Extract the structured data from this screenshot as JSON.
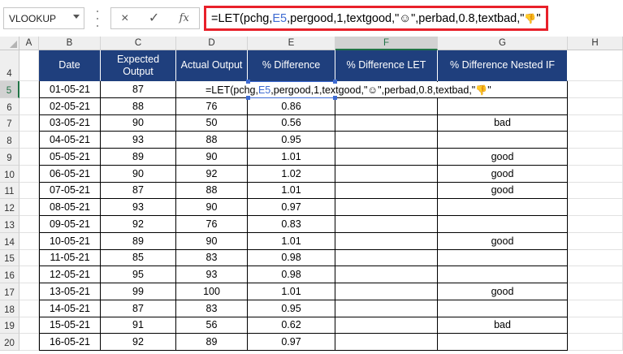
{
  "formula_bar": {
    "name_box": "VLOOKUP",
    "cancel_icon": "×",
    "enter_icon": "✓",
    "fx_label": "fx",
    "formula_prefix": "=LET(pchg,",
    "formula_ref": "E5",
    "formula_mid": ",pergood,1,textgood,\"",
    "smiley": "☺",
    "formula_mid2": "\",perbad,0.8,textbad,\"",
    "thumbs_down": "👎",
    "formula_suffix": "\""
  },
  "columns": [
    "A",
    "B",
    "C",
    "D",
    "E",
    "F",
    "G",
    "H"
  ],
  "selected_column": "F",
  "selected_row": "5",
  "headers": {
    "date": "Date",
    "expected_line1": "Expected",
    "expected_line2": "Output",
    "actual": "Actual Output",
    "pct_diff": "% Difference",
    "pct_let": "% Difference LET",
    "pct_nested": "% Difference Nested IF"
  },
  "row_numbers": [
    "4",
    "5",
    "6",
    "7",
    "8",
    "9",
    "10",
    "11",
    "12",
    "13",
    "14",
    "15",
    "16",
    "17",
    "18",
    "19",
    "20"
  ],
  "rows": [
    {
      "row": "5",
      "date": "01-05-21",
      "expected": "87",
      "actual": "",
      "pct": "",
      "let": "",
      "nested": ""
    },
    {
      "row": "6",
      "date": "02-05-21",
      "expected": "88",
      "actual": "76",
      "pct": "0.86",
      "let": "",
      "nested": ""
    },
    {
      "row": "7",
      "date": "03-05-21",
      "expected": "90",
      "actual": "50",
      "pct": "0.56",
      "let": "",
      "nested": "bad"
    },
    {
      "row": "8",
      "date": "04-05-21",
      "expected": "93",
      "actual": "88",
      "pct": "0.95",
      "let": "",
      "nested": ""
    },
    {
      "row": "9",
      "date": "05-05-21",
      "expected": "89",
      "actual": "90",
      "pct": "1.01",
      "let": "",
      "nested": "good"
    },
    {
      "row": "10",
      "date": "06-05-21",
      "expected": "90",
      "actual": "92",
      "pct": "1.02",
      "let": "",
      "nested": "good"
    },
    {
      "row": "11",
      "date": "07-05-21",
      "expected": "87",
      "actual": "88",
      "pct": "1.01",
      "let": "",
      "nested": "good"
    },
    {
      "row": "12",
      "date": "08-05-21",
      "expected": "93",
      "actual": "90",
      "pct": "0.97",
      "let": "",
      "nested": ""
    },
    {
      "row": "13",
      "date": "09-05-21",
      "expected": "92",
      "actual": "76",
      "pct": "0.83",
      "let": "",
      "nested": ""
    },
    {
      "row": "14",
      "date": "10-05-21",
      "expected": "89",
      "actual": "90",
      "pct": "1.01",
      "let": "",
      "nested": "good"
    },
    {
      "row": "15",
      "date": "11-05-21",
      "expected": "85",
      "actual": "83",
      "pct": "0.98",
      "let": "",
      "nested": ""
    },
    {
      "row": "16",
      "date": "12-05-21",
      "expected": "95",
      "actual": "93",
      "pct": "0.98",
      "let": "",
      "nested": ""
    },
    {
      "row": "17",
      "date": "13-05-21",
      "expected": "99",
      "actual": "100",
      "pct": "1.01",
      "let": "",
      "nested": "good"
    },
    {
      "row": "18",
      "date": "14-05-21",
      "expected": "87",
      "actual": "83",
      "pct": "0.95",
      "let": "",
      "nested": ""
    },
    {
      "row": "19",
      "date": "15-05-21",
      "expected": "91",
      "actual": "56",
      "pct": "0.62",
      "let": "",
      "nested": "bad"
    },
    {
      "row": "20",
      "date": "16-05-21",
      "expected": "92",
      "actual": "89",
      "pct": "0.97",
      "let": "",
      "nested": ""
    }
  ],
  "colors": {
    "header_fill": "#1f3f7d",
    "formula_highlight": "#e8202a",
    "reference_blue": "#3e6bd2",
    "excel_green": "#217346"
  }
}
